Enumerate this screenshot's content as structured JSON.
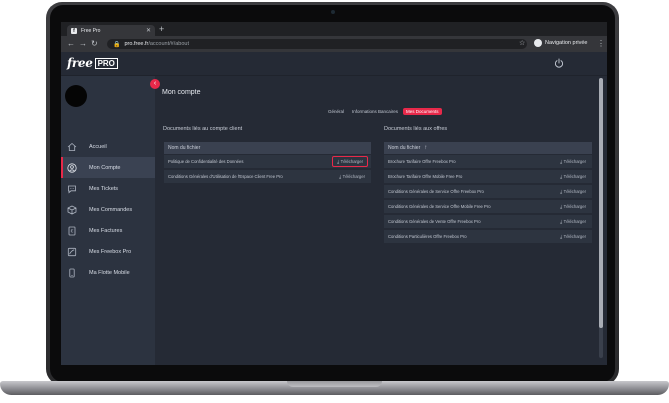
{
  "browser": {
    "tab_title": "Free Pro",
    "url_host": "pro.free.fr",
    "url_path": "/account/#/about",
    "incognito_label": "Navigation privée"
  },
  "header": {
    "logo_text": "free",
    "logo_badge": "PRO"
  },
  "sidebar": {
    "items": [
      {
        "label": "Accueil",
        "icon": "home-icon"
      },
      {
        "label": "Mon Compte",
        "icon": "user-icon"
      },
      {
        "label": "Mes Tickets",
        "icon": "chat-icon"
      },
      {
        "label": "Mes Commandes",
        "icon": "box-icon"
      },
      {
        "label": "Mes Factures",
        "icon": "invoice-icon"
      },
      {
        "label": "Mes Freebox Pro",
        "icon": "freebox-icon"
      },
      {
        "label": "Ma Flotte Mobile",
        "icon": "phone-icon"
      }
    ]
  },
  "main": {
    "title": "Mon compte",
    "tabs": [
      "Général",
      "Informations Bancaires",
      "Mes Documents"
    ],
    "account_docs": {
      "title": "Documents liés au compte client",
      "column": "Nom du fichier",
      "rows": [
        {
          "name": "Politique de Confidentialité des Données",
          "action": "Télécharger"
        },
        {
          "name": "Conditions Générales d'Utilisation de l'Espace Client Free Pro",
          "action": "Télécharger"
        }
      ]
    },
    "offer_docs": {
      "title": "Documents liés aux offres",
      "column": "Nom du fichier",
      "rows": [
        {
          "name": "Brochure Tarifaire Offre Freebox Pro",
          "action": "Télécharger"
        },
        {
          "name": "Brochure Tarifaire Offre Mobile Free Pro",
          "action": "Télécharger"
        },
        {
          "name": "Conditions Générales de Service Offre Freebox Pro",
          "action": "Télécharger"
        },
        {
          "name": "Conditions Générales de Service Offre Mobile Free Pro",
          "action": "Télécharger"
        },
        {
          "name": "Conditions Générales de Vente Offre Freebox Pro",
          "action": "Télécharger"
        },
        {
          "name": "Conditions Particulières Offre Freebox Pro",
          "action": "Télécharger"
        }
      ]
    }
  },
  "colors": {
    "accent": "#e8294a",
    "sidebar_bg": "#2c3340",
    "main_bg": "#252a35"
  }
}
